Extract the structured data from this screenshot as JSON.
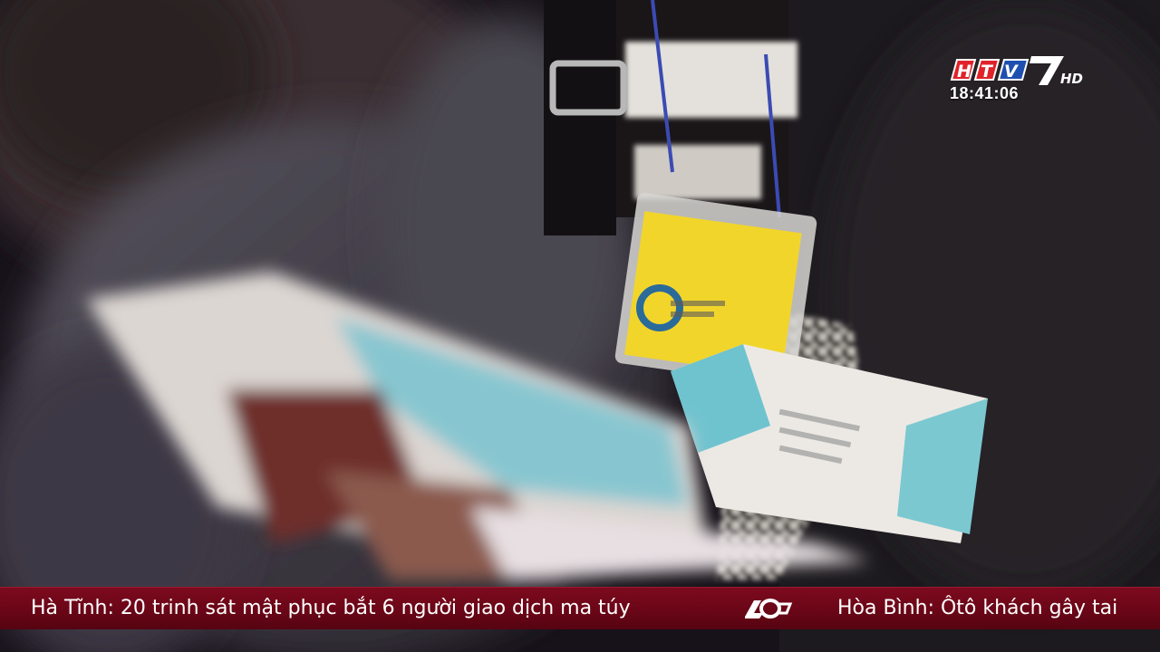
{
  "channel": {
    "logo_text": "HTV7",
    "logo_suffix": "HD",
    "clock": "18:41:06",
    "colors": {
      "logo_red": "#e0222a",
      "logo_blue": "#1f4fb0",
      "ticker_bg": "#6a0617"
    }
  },
  "ticker": {
    "items": [
      "Hà Tĩnh: 20 trinh sát mật phục bắt 6 người giao dịch ma túy",
      "Hòa Bình: Ôtô khách gây tai"
    ],
    "separator_icon": "htv-60-years-icon"
  }
}
